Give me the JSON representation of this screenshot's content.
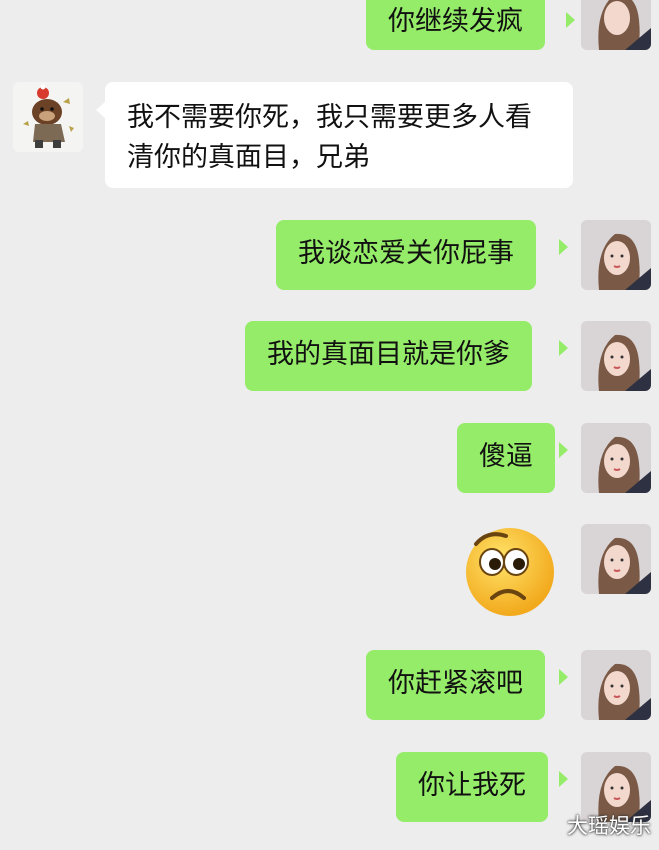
{
  "chat": {
    "messages": [
      {
        "sender": "me",
        "text": "你继续发疯"
      },
      {
        "sender": "other",
        "text": "我不需要你死，我只需要更多人看清你的真面目，兄弟"
      },
      {
        "sender": "me",
        "text": "我谈恋爱关你屁事"
      },
      {
        "sender": "me",
        "text": "我的真面目就是你爹"
      },
      {
        "sender": "me",
        "text": "傻逼"
      },
      {
        "sender": "me",
        "sticker": "worried-face-emoji"
      },
      {
        "sender": "me",
        "text": "你赶紧滚吧"
      },
      {
        "sender": "me",
        "text": "你让我死"
      }
    ]
  },
  "watermark": "大瑶娱乐",
  "colors": {
    "background": "#ededed",
    "my_bubble": "#95ec69",
    "other_bubble": "#ffffff"
  }
}
